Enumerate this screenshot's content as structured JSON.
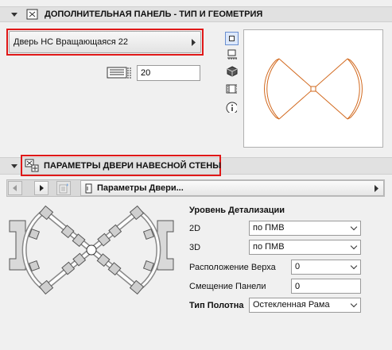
{
  "panel1": {
    "title": "ДОПОЛНИТЕЛЬНАЯ ПАНЕЛЬ - ТИП И ГЕОМЕТРИЯ",
    "door_type": "Дверь НС Вращающаяся 22",
    "width_value": "20"
  },
  "panel2": {
    "title": "ПАРАМЕТРЫ ДВЕРИ НАВЕСНОЙ СТЕНЫ",
    "page_selector": "Параметры Двери..."
  },
  "params": {
    "detail_heading": "Уровень Детализации",
    "label_2d": "2D",
    "value_2d": "по ПМВ",
    "label_3d": "3D",
    "value_3d": "по ПМВ",
    "top_position_label": "Расположение Верха",
    "top_position_value": "0",
    "panel_offset_label": "Смещение Панели",
    "panel_offset_value": "0",
    "leaf_type_label": "Тип Полотна",
    "leaf_type_value": "Остекленная Рама"
  },
  "colors": {
    "highlight": "#e01818",
    "preview_lines": "#d2691e"
  }
}
